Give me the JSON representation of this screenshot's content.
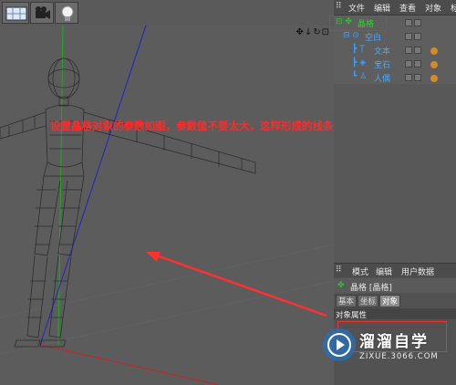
{
  "menubar": {
    "file": "文件",
    "edit": "编辑",
    "view": "查看",
    "object": "对象",
    "more": "标"
  },
  "objects": [
    {
      "name": "晶格",
      "color": "#22cc22",
      "icon": "lattice-icon"
    },
    {
      "name": "空白",
      "color": "#3aa0ff",
      "icon": "null-icon"
    },
    {
      "name": "文本",
      "color": "#3aa0ff",
      "icon": "text-icon"
    },
    {
      "name": "宝石",
      "color": "#3aa0ff",
      "icon": "gem-icon"
    },
    {
      "name": "人偶",
      "color": "#3aa0ff",
      "icon": "figure-icon"
    }
  ],
  "attr_menubar": {
    "mode": "模式",
    "edit": "编辑",
    "userdata": "用户数据"
  },
  "attr_title": "晶格 [晶格]",
  "attr_tabs": [
    "基本",
    "坐标",
    "对象"
  ],
  "attr_section": "对象属性",
  "annotation": "设置晶格对象的参数如图，参数值不要太大，这样形成的线条细些",
  "viewport_nav": "✥↓↻⊡",
  "watermark": {
    "brand": "溜溜自学",
    "url": "ZIXUE.3066.COM"
  },
  "colors": {
    "annotation": "#ff2a2a",
    "axis_y": "#22aa22",
    "axis_z": "#2222cc",
    "arrow": "#ff3030"
  }
}
